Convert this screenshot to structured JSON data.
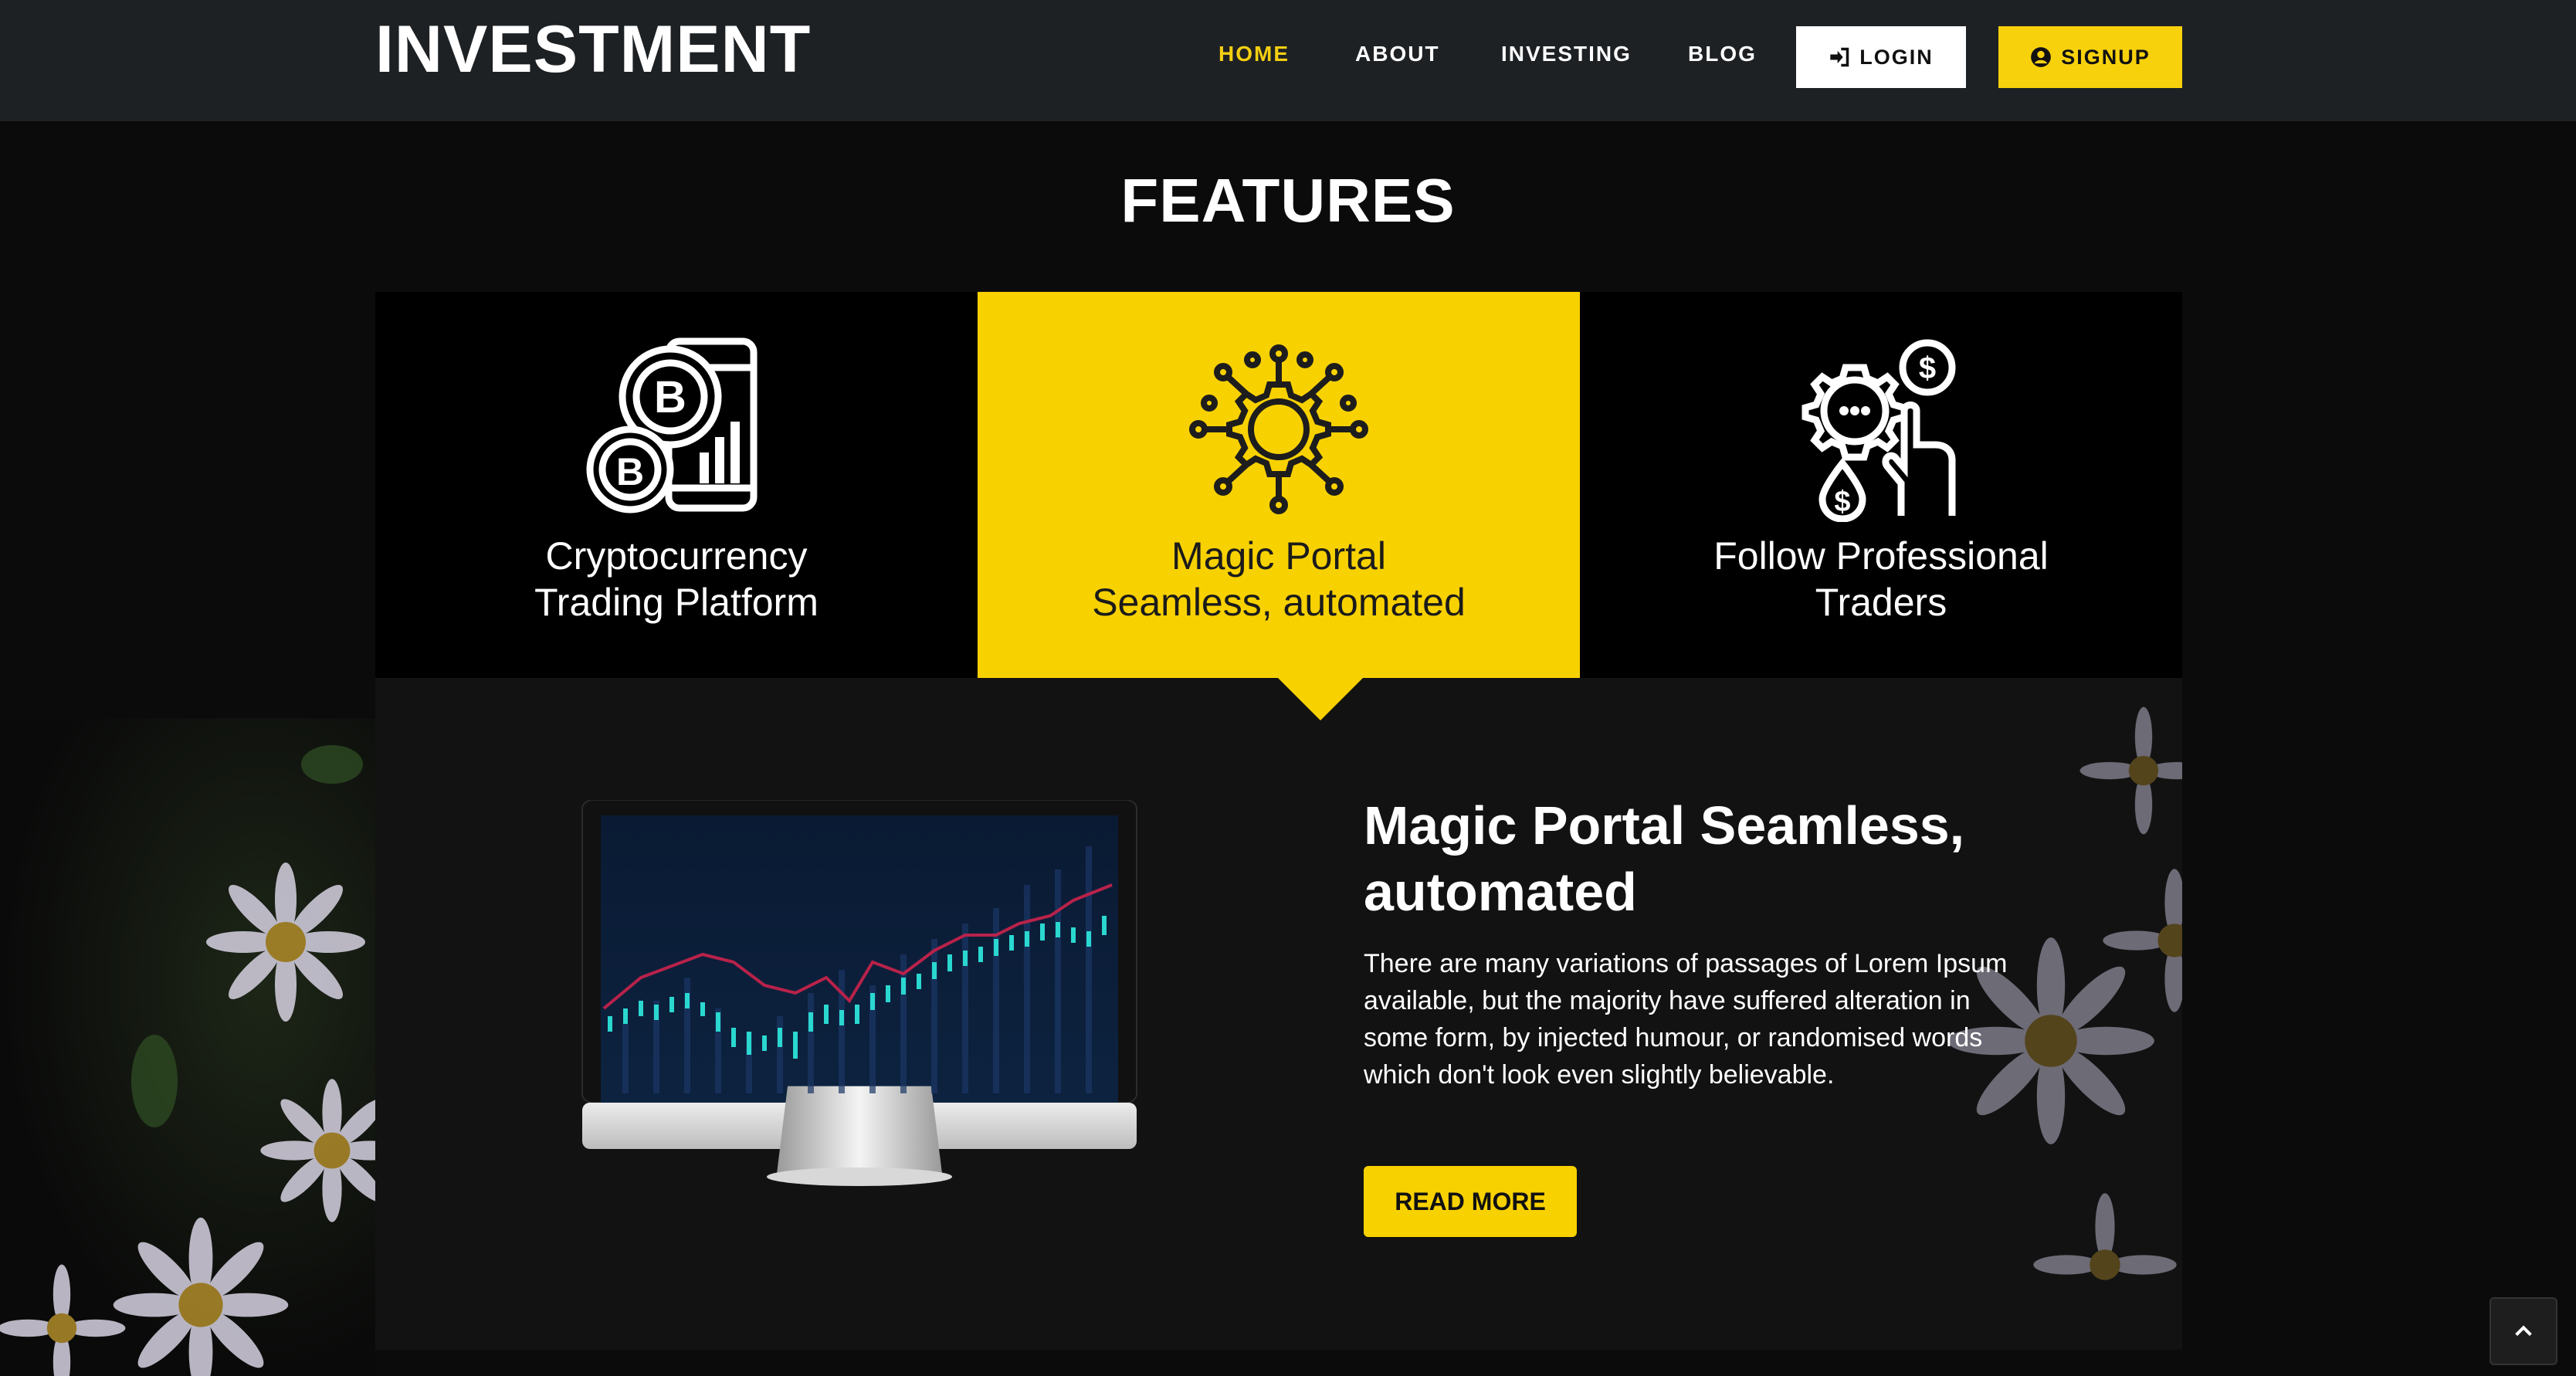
{
  "header": {
    "logo": "INVESTMENT",
    "nav": [
      {
        "label": "HOME",
        "active": true
      },
      {
        "label": "ABOUT",
        "active": false
      },
      {
        "label": "INVESTING",
        "active": false
      },
      {
        "label": "BLOG",
        "active": false
      }
    ],
    "login_label": "LOGIN",
    "signup_label": "SIGNUP",
    "login_icon": "sign-in-icon",
    "signup_icon": "user-circle-icon"
  },
  "features": {
    "title": "FEATURES",
    "tabs": [
      {
        "line1": "Cryptocurrency",
        "line2": "Trading Platform",
        "icon": "bitcoin-phone-icon",
        "active": false
      },
      {
        "line1": "Magic Portal",
        "line2": "Seamless, automated",
        "icon": "gear-network-icon",
        "active": true
      },
      {
        "line1": "Follow Professional",
        "line2": "Traders",
        "icon": "gear-dollar-hand-icon",
        "active": false
      }
    ]
  },
  "panel": {
    "title": "Magic Portal Seamless, automated",
    "description": "There are many variations of passages of Lorem Ipsum available, but the majority have suffered alteration in some form, by injected humour, or randomised words which don't look even slightly believable.",
    "button_label": "READ MORE",
    "image": "monitor-trading-chart"
  },
  "colors": {
    "accent": "#f8d100",
    "header_bg": "#1e2124",
    "page_bg": "#0b0b0b",
    "panel_bg": "#121212"
  },
  "back_to_top_icon": "chevron-up-icon"
}
